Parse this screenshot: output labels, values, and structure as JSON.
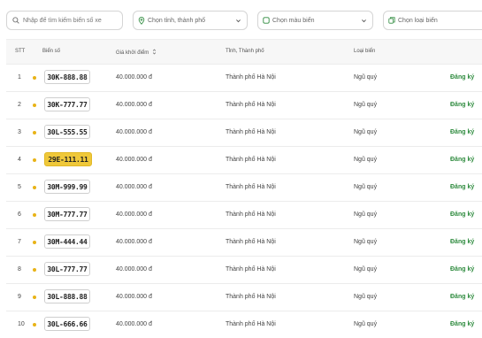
{
  "filters": {
    "search_placeholder": "Nhập để tìm kiếm biển số xe",
    "city_placeholder": "Chọn tỉnh, thành phố",
    "color_placeholder": "Chọn màu biển",
    "type_placeholder": "Chọn loại biển"
  },
  "table": {
    "headers": {
      "stt": "STT",
      "plate": "Biển số",
      "price": "Giá khởi điểm",
      "city": "Tỉnh, Thành phố",
      "type": "Loại biển"
    },
    "rows": [
      {
        "stt": "1",
        "plate": "30K-888.88",
        "price": "40.000.000 đ",
        "city": "Thành phố Hà Nội",
        "type": "Ngũ quý",
        "action": "Đăng ký"
      },
      {
        "stt": "2",
        "plate": "30K-777.77",
        "price": "40.000.000 đ",
        "city": "Thành phố Hà Nội",
        "type": "Ngũ quý",
        "action": "Đăng ký"
      },
      {
        "stt": "3",
        "plate": "30L-555.55",
        "price": "40.000.000 đ",
        "city": "Thành phố Hà Nội",
        "type": "Ngũ quý",
        "action": "Đăng ký"
      },
      {
        "stt": "4",
        "plate": "29E-111.11",
        "price": "40.000.000 đ",
        "city": "Thành phố Hà Nội",
        "type": "Ngũ quý",
        "action": "Đăng ký",
        "plate_color": "#efc83a"
      },
      {
        "stt": "5",
        "plate": "30M-999.99",
        "price": "40.000.000 đ",
        "city": "Thành phố Hà Nội",
        "type": "Ngũ quý",
        "action": "Đăng ký"
      },
      {
        "stt": "6",
        "plate": "30M-777.77",
        "price": "40.000.000 đ",
        "city": "Thành phố Hà Nội",
        "type": "Ngũ quý",
        "action": "Đăng ký"
      },
      {
        "stt": "7",
        "plate": "30M-444.44",
        "price": "40.000.000 đ",
        "city": "Thành phố Hà Nội",
        "type": "Ngũ quý",
        "action": "Đăng ký"
      },
      {
        "stt": "8",
        "plate": "30L-777.77",
        "price": "40.000.000 đ",
        "city": "Thành phố Hà Nội",
        "type": "Ngũ quý",
        "action": "Đăng ký"
      },
      {
        "stt": "9",
        "plate": "30L-888.88",
        "price": "40.000.000 đ",
        "city": "Thành phố Hà Nội",
        "type": "Ngũ quý",
        "action": "Đăng ký"
      },
      {
        "stt": "10",
        "plate": "30L-666.66",
        "price": "40.000.000 đ",
        "city": "Thành phố Hà Nội",
        "type": "Ngũ quý",
        "action": "Đăng ký"
      }
    ]
  },
  "colors": {
    "accent_green": "#2e8b3e",
    "status_dot": "#e8b317",
    "yellow_plate": "#efc83a"
  },
  "icons": {
    "search": "search-icon",
    "location": "map-pin-icon",
    "color": "square-icon",
    "type": "copy-icon",
    "dropdown": "chevron-down-icon",
    "sort": "sort-icon"
  }
}
